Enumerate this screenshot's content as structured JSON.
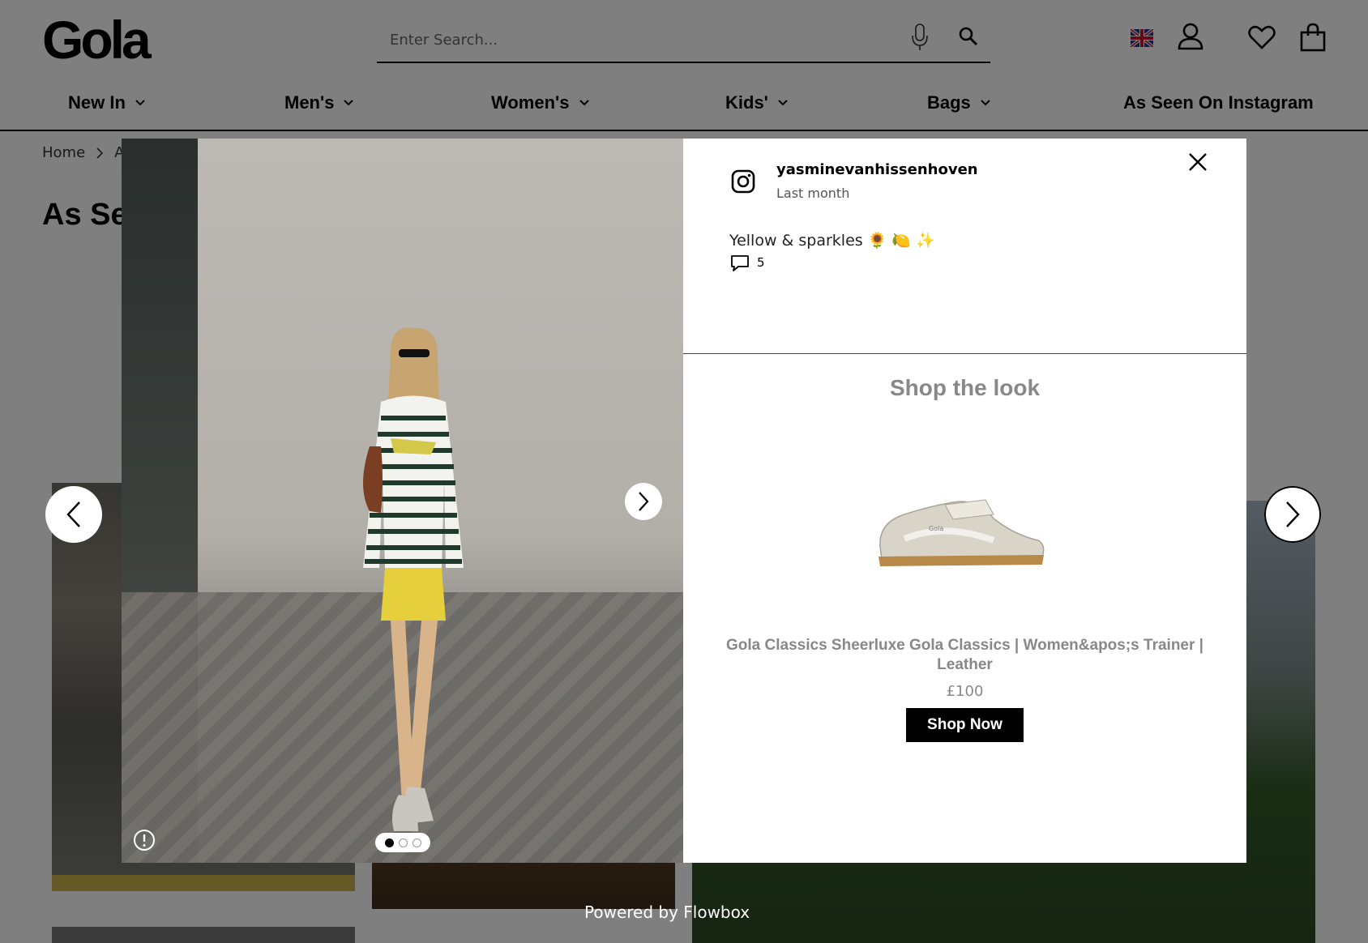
{
  "header": {
    "logo": "Gola",
    "search_placeholder": "Enter Search...",
    "icons": [
      "mic-icon",
      "search-icon",
      "uk-flag-icon",
      "account-icon",
      "heart-icon",
      "bag-icon"
    ]
  },
  "nav": {
    "items": [
      {
        "label": "New In"
      },
      {
        "label": "Men's"
      },
      {
        "label": "Women's"
      },
      {
        "label": "Kids'"
      },
      {
        "label": "Bags"
      },
      {
        "label": "As Seen On Instagram"
      }
    ]
  },
  "breadcrumb": {
    "home": "Home",
    "current": "As"
  },
  "page": {
    "title": "As See",
    "powered_by": "Powered by Flowbox"
  },
  "modal": {
    "post": {
      "username": "yasminevanhissenhoven",
      "posted": "Last month",
      "caption": "Yellow & sparkles 🌻 🍋 ✨",
      "comment_count": "5"
    },
    "carousel": {
      "slides": 3,
      "active_index": 0
    },
    "shop": {
      "title": "Shop the look",
      "product_name": "Gola Classics Sheerluxe Gola Classics | Women&apos;s Trainer | Leather",
      "price": "£100",
      "button_label": "Shop Now"
    }
  }
}
